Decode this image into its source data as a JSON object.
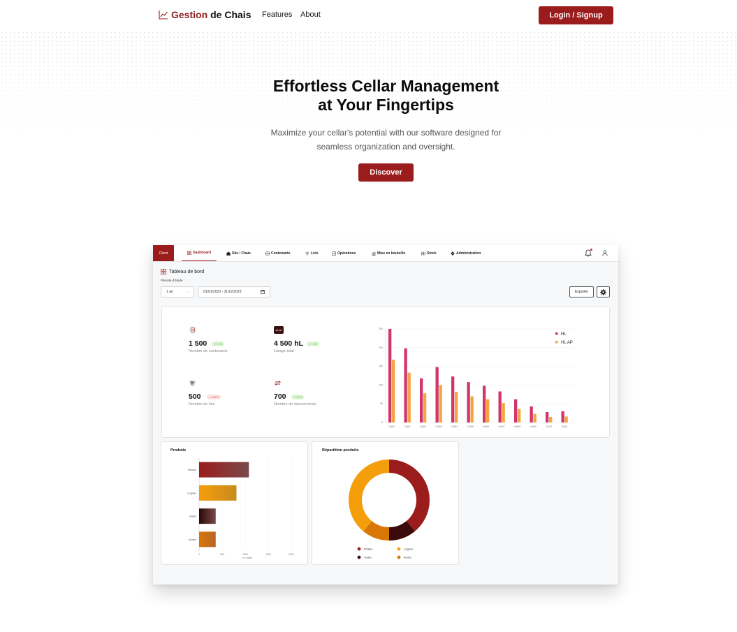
{
  "nav": {
    "brand_part1": "Gestion",
    "brand_part2": "de Chais",
    "links": [
      "Features",
      "About"
    ],
    "login_label": "Login / Signup"
  },
  "hero": {
    "title_line1": "Effortless Cellar Management",
    "title_line2": "at Your Fingertips",
    "subtitle_line1": "Maximize your cellar's potential with our software designed for",
    "subtitle_line2": "seamless organization and oversight.",
    "cta_label": "Discover"
  },
  "colors": {
    "brand": "#9b1c1c",
    "hl": "#d1356b",
    "hl_ap": "#f2a541",
    "whisky": "#9b1c1c",
    "cognac": "#f59e0b",
    "vodka": "#3b0a0a",
    "autres": "#d97706"
  },
  "dashboard": {
    "client_label": "Client",
    "tabs": [
      {
        "label": "Dashboard",
        "icon": "grid-icon"
      },
      {
        "label": "Site / Chais",
        "icon": "warehouse-icon"
      },
      {
        "label": "Contenants",
        "icon": "barrel-icon"
      },
      {
        "label": "Lots",
        "icon": "grapes-icon"
      },
      {
        "label": "Opérations",
        "icon": "operations-icon"
      },
      {
        "label": "Mise en bouteille",
        "icon": "bottling-icon"
      },
      {
        "label": "Stock",
        "icon": "stock-icon"
      },
      {
        "label": "Administration",
        "icon": "gear-icon"
      }
    ],
    "page_title": "Tableau de bord",
    "period_label": "Période d'étude :",
    "period_value": "1 an",
    "date_range": "01/01/2023 - 31/12/2023",
    "export_label": "Exporter",
    "stats": [
      {
        "value": "1 500",
        "badge": "↗ +4 %",
        "trend": "up",
        "label": "Nombre de contenants",
        "icon": "document-icon"
      },
      {
        "value": "4 500 hL",
        "badge": "↗ +4 %",
        "trend": "up",
        "label": "Litrage total",
        "icon": "hl-ap-icon",
        "icon_text": "HL AP"
      },
      {
        "value": "500",
        "badge": "↘ -0.3 %",
        "trend": "down",
        "label": "Nombre de lots",
        "icon": "grapes-icon"
      },
      {
        "value": "700",
        "badge": "↗ +4 %",
        "trend": "up",
        "label": "Nombre de mouvements",
        "icon": "exchange-icon"
      }
    ],
    "products_title": "Produits",
    "distribution_title": "Répartition produits"
  },
  "chart_data": [
    {
      "type": "bar",
      "categories": [
        "Cat00",
        "Cat01",
        "Cat02",
        "Cat03",
        "Cat04",
        "Cat05",
        "Cat06",
        "Cat07",
        "Cat08",
        "Cat09",
        "Cat10",
        "Cat11"
      ],
      "series": [
        {
          "name": "HL",
          "values": [
            250,
            198,
            118,
            148,
            123,
            108,
            98,
            83,
            62,
            43,
            28,
            30
          ]
        },
        {
          "name": "HL AP",
          "values": [
            168,
            133,
            78,
            100,
            82,
            70,
            62,
            52,
            36,
            23,
            15,
            16
          ]
        }
      ],
      "ylim": [
        0,
        250
      ],
      "yticks": [
        0,
        50,
        100,
        150,
        200,
        250
      ],
      "grid": true,
      "legend": "top-right"
    },
    {
      "type": "bar",
      "orientation": "horizontal",
      "categories": [
        "Whisky",
        "Cognac",
        "Vodka",
        "Autres"
      ],
      "values": [
        1080,
        810,
        360,
        360
      ],
      "xlim": [
        0,
        2000
      ],
      "xticks": [
        0,
        500,
        1000,
        1500,
        2000
      ],
      "xlabel": "en unités",
      "grid": true
    },
    {
      "type": "pie",
      "variant": "donut",
      "labels": [
        "Whisky",
        "Vodka",
        "Autres",
        "Cognac"
      ],
      "values": [
        39,
        11,
        11,
        39
      ],
      "legend": "bottom"
    }
  ]
}
